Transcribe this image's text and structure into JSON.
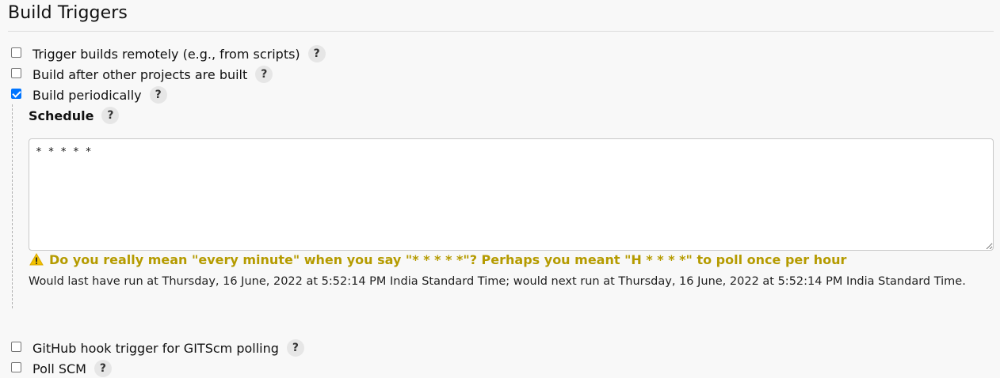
{
  "section": {
    "title": "Build Triggers"
  },
  "triggers": [
    {
      "label": "Trigger builds remotely (e.g., from scripts)",
      "checked": false,
      "help": "?"
    },
    {
      "label": "Build after other projects are built",
      "checked": false,
      "help": "?"
    },
    {
      "label": "Build periodically",
      "checked": true,
      "help": "?"
    }
  ],
  "schedule": {
    "label": "Schedule",
    "help": "?",
    "value": "* * * * *",
    "warning": "Do you really mean \"every minute\" when you say \"* * * * *\"? Perhaps you meant \"H * * * *\" to poll once per hour",
    "run_info": "Would last have run at Thursday, 16 June, 2022 at 5:52:14 PM India Standard Time; would next run at Thursday, 16 June, 2022 at 5:52:14 PM India Standard Time.",
    "warning_color": "#b59b00"
  },
  "more_triggers": [
    {
      "label": "GitHub hook trigger for GITScm polling",
      "checked": false,
      "help": "?"
    },
    {
      "label": "Poll SCM",
      "checked": false,
      "help": "?"
    }
  ]
}
